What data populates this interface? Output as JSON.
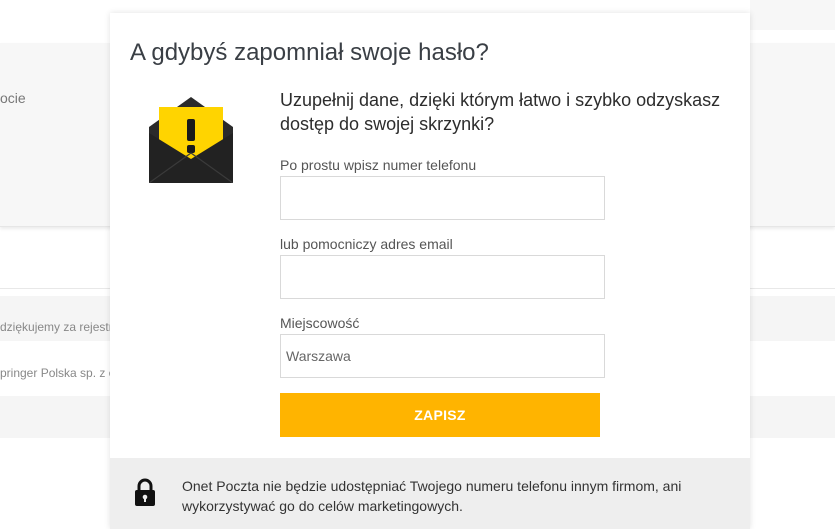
{
  "background": {
    "partial_text_1": "ocie",
    "partial_text_2": "dziękujemy za rejestra",
    "partial_text_3": "pringer Polska sp. z o"
  },
  "modal": {
    "title": "A gdybyś zapomniał swoje hasło?",
    "lead": "Uzupełnij dane, dzięki którym łatwo i szybko odzyskasz dostęp do swojej skrzynki?",
    "phone": {
      "label": "Po prostu wpisz numer telefonu",
      "value": ""
    },
    "email": {
      "label": "lub pomocniczy adres email",
      "value": ""
    },
    "city": {
      "label": "Miejscowość",
      "placeholder": "Warszawa"
    },
    "save_label": "ZAPISZ",
    "footer_text": "Onet Poczta nie będzie udostępniać Twojego numeru telefonu innym firmom, ani wykorzystywać go do celów marketingowych.",
    "icons": {
      "envelope": "warning-envelope-icon",
      "lock": "lock-icon"
    },
    "colors": {
      "accent": "#ffb400",
      "envelope": "#2b2b2b",
      "warning": "#ffd400"
    }
  }
}
